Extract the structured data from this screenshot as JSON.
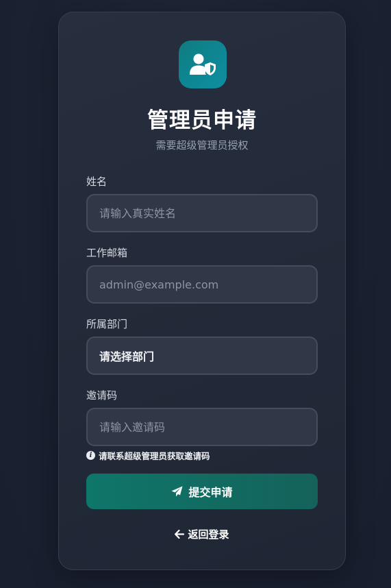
{
  "header": {
    "title": "管理员申请",
    "subtitle": "需要超级管理员授权"
  },
  "form": {
    "name": {
      "label": "姓名",
      "placeholder": "请输入真实姓名",
      "value": ""
    },
    "email": {
      "label": "工作邮箱",
      "placeholder": "admin@example.com",
      "value": ""
    },
    "department": {
      "label": "所属部门",
      "selected": "请选择部门"
    },
    "invite_code": {
      "label": "邀请码",
      "placeholder": "请输入邀请码",
      "value": ""
    },
    "hint": "请联系超级管理员获取邀请码",
    "submit_label": "提交申请",
    "back_label": "返回登录"
  },
  "icons": {
    "logo": "user-shield-icon",
    "hint": "info-circle-icon",
    "submit": "paper-plane-icon",
    "back": "arrow-left-icon"
  },
  "colors": {
    "background": "#1a2131",
    "card": "#252c3b",
    "input": "#303747",
    "accent": "#0f766b",
    "logo": "#0e8fa3"
  }
}
